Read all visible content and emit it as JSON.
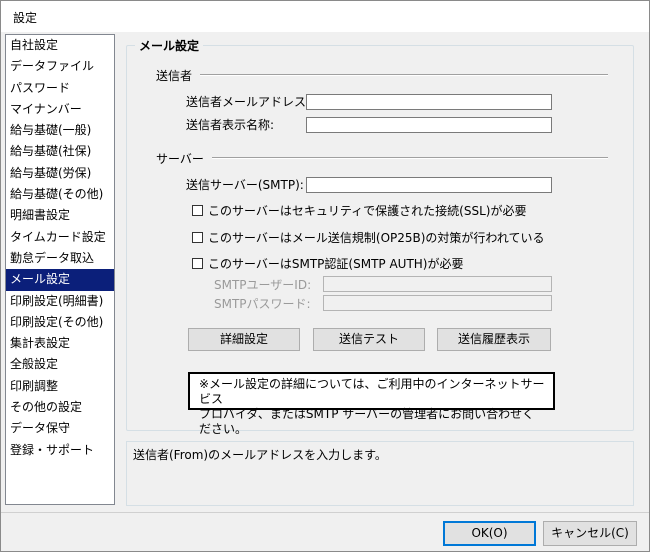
{
  "window": {
    "title": "設定"
  },
  "nav": {
    "items": [
      {
        "label": "自社設定"
      },
      {
        "label": "データファイル"
      },
      {
        "label": "パスワード"
      },
      {
        "label": "マイナンバー"
      },
      {
        "label": "給与基礎(一般)"
      },
      {
        "label": "給与基礎(社保)"
      },
      {
        "label": "給与基礎(労保)"
      },
      {
        "label": "給与基礎(その他)"
      },
      {
        "label": "明細書設定"
      },
      {
        "label": "タイムカード設定"
      },
      {
        "label": "勤怠データ取込"
      },
      {
        "label": "メール設定",
        "selected": true
      },
      {
        "label": "印刷設定(明細書)"
      },
      {
        "label": "印刷設定(その他)"
      },
      {
        "label": "集計表設定"
      },
      {
        "label": "全般設定"
      },
      {
        "label": "印刷調整"
      },
      {
        "label": "その他の設定"
      },
      {
        "label": "データ保守"
      },
      {
        "label": "登録・サポート"
      }
    ]
  },
  "mail": {
    "group_title": "メール設定",
    "sender_section": "送信者",
    "sender_address_label": "送信者メールアドレス:",
    "sender_address_value": "",
    "sender_name_label": "送信者表示名称:",
    "sender_name_value": "",
    "server_section": "サーバー",
    "smtp_label": "送信サーバー(SMTP):",
    "smtp_value": "",
    "ssl_label": "このサーバーはセキュリティで保護された接続(SSL)が必要",
    "op25b_label": "このサーバーはメール送信規制(OP25B)の対策が行われている",
    "auth_label": "このサーバーはSMTP認証(SMTP AUTH)が必要",
    "smtp_user_label": "SMTPユーザーID:",
    "smtp_password_label": "SMTPパスワード:",
    "detail_button": "詳細設定",
    "test_button": "送信テスト",
    "history_button": "送信履歴表示",
    "notice_line1": "※メール設定の詳細については、ご利用中のインターネットサービス",
    "notice_line2": "プロバイダ、またはSMTP サーバーの管理者にお問い合わせください。"
  },
  "help_text": "送信者(From)のメールアドレスを入力します。",
  "footer": {
    "ok_label": "OK(O)",
    "cancel_label": "キャンセル(C)"
  }
}
